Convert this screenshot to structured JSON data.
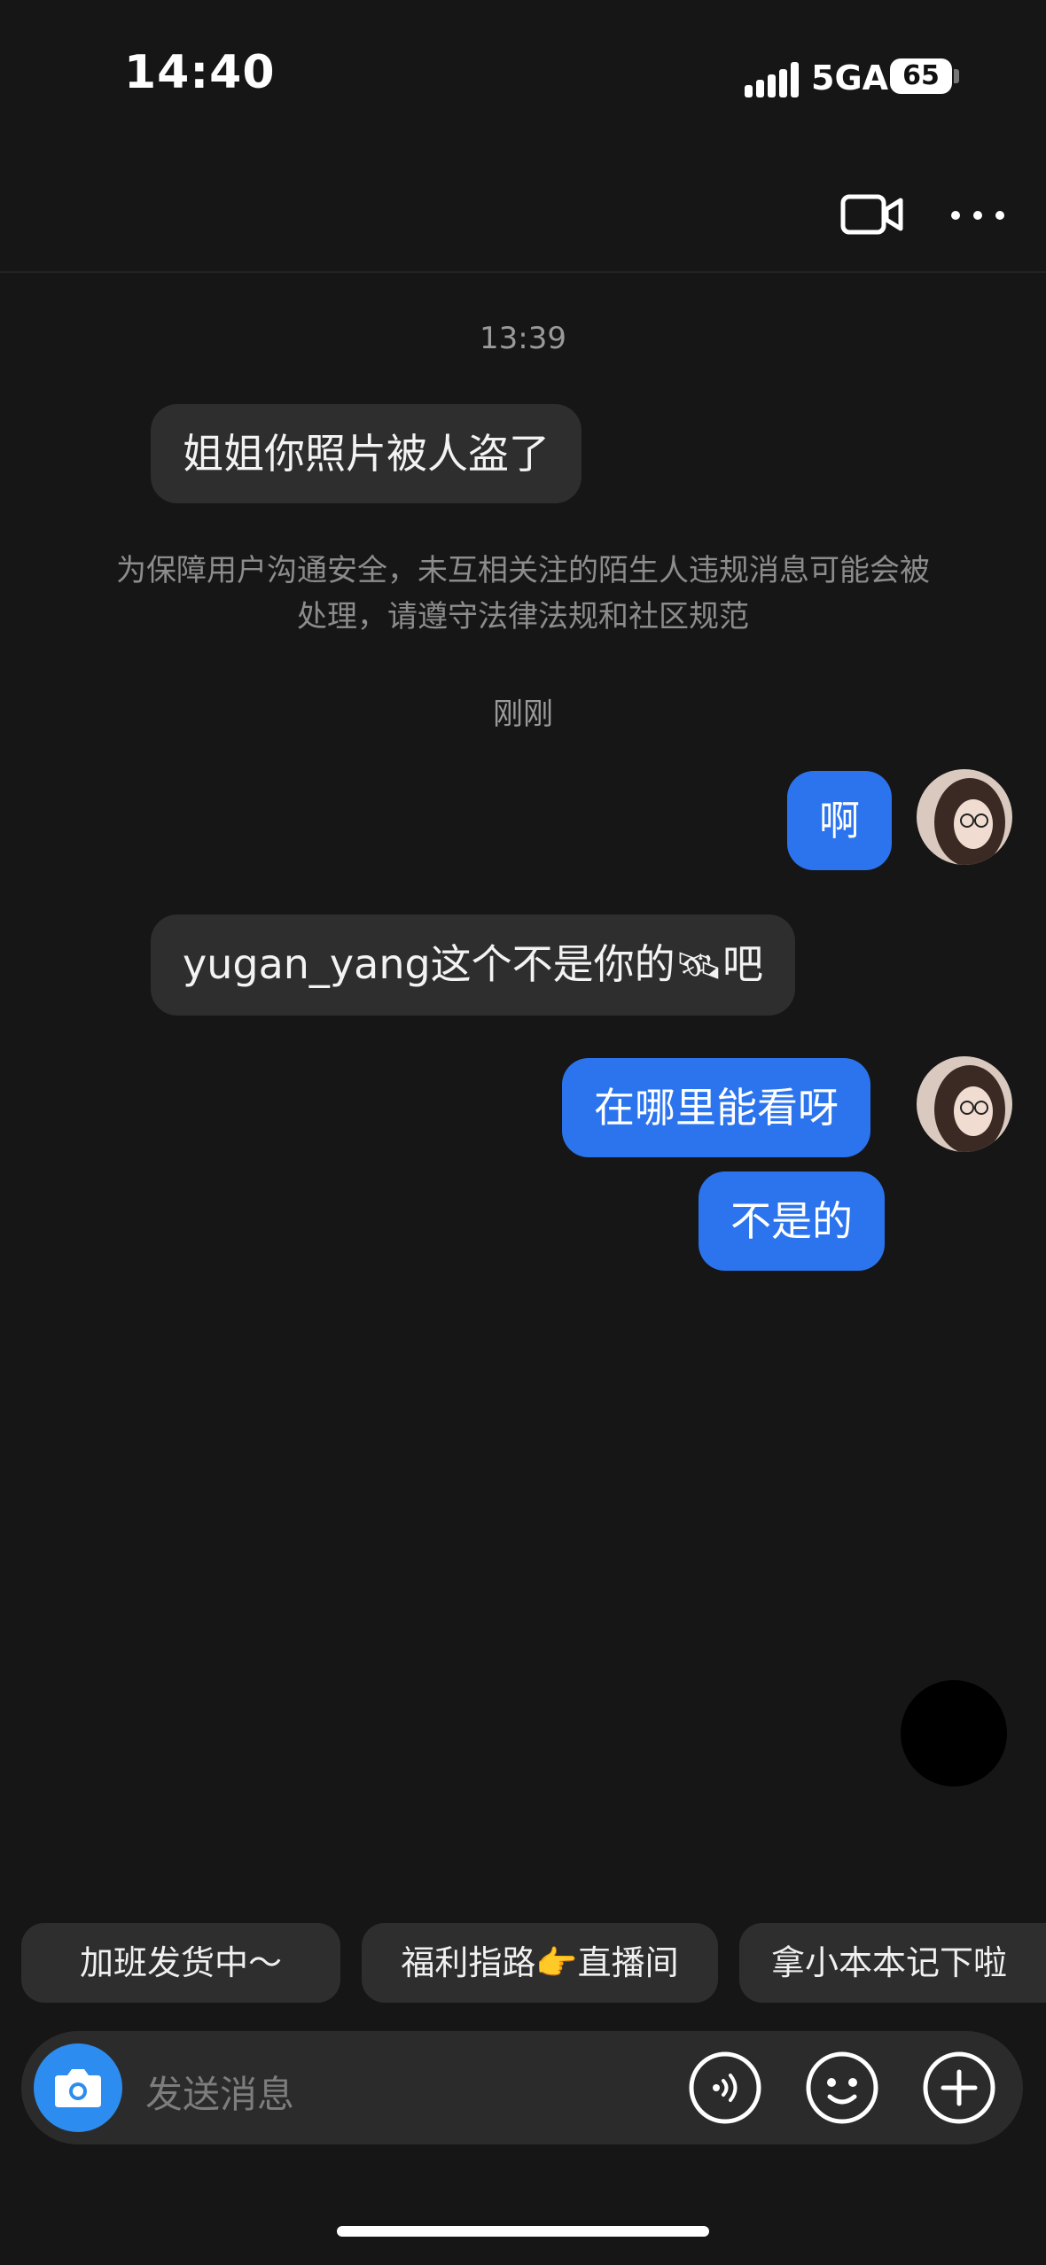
{
  "status": {
    "time": "14:40",
    "network": "5GA",
    "battery": "65"
  },
  "header": {
    "video_icon": "video-camera-icon",
    "more_icon": "more-dots-icon"
  },
  "messages": {
    "ts1": "13:39",
    "m1": "姐姐你照片被人盗了",
    "notice": "为保障用户沟通安全，未互相关注的陌生人违规消息可能会被处理，请遵守法律法规和社区规范",
    "ts2": "刚刚",
    "m2": "啊",
    "m3_text": "yugan_yang这个不是你的",
    "m3_emoji": "🛰",
    "m3_tail": "吧",
    "m4": "在哪里能看呀",
    "m5": "不是的"
  },
  "quick_replies": [
    "加班发货中～",
    "福利指路👉直播间",
    "拿小本本记下啦"
  ],
  "input": {
    "placeholder": "发送消息",
    "camera_icon": "camera-icon",
    "voice_icon": "voice-icon",
    "emoji_icon": "emoji-icon",
    "plus_icon": "plus-icon"
  },
  "colors": {
    "background": "#161616",
    "outgoing": "#2b74ee",
    "incoming": "#2e2e2e",
    "camera": "#2d8cf0"
  }
}
